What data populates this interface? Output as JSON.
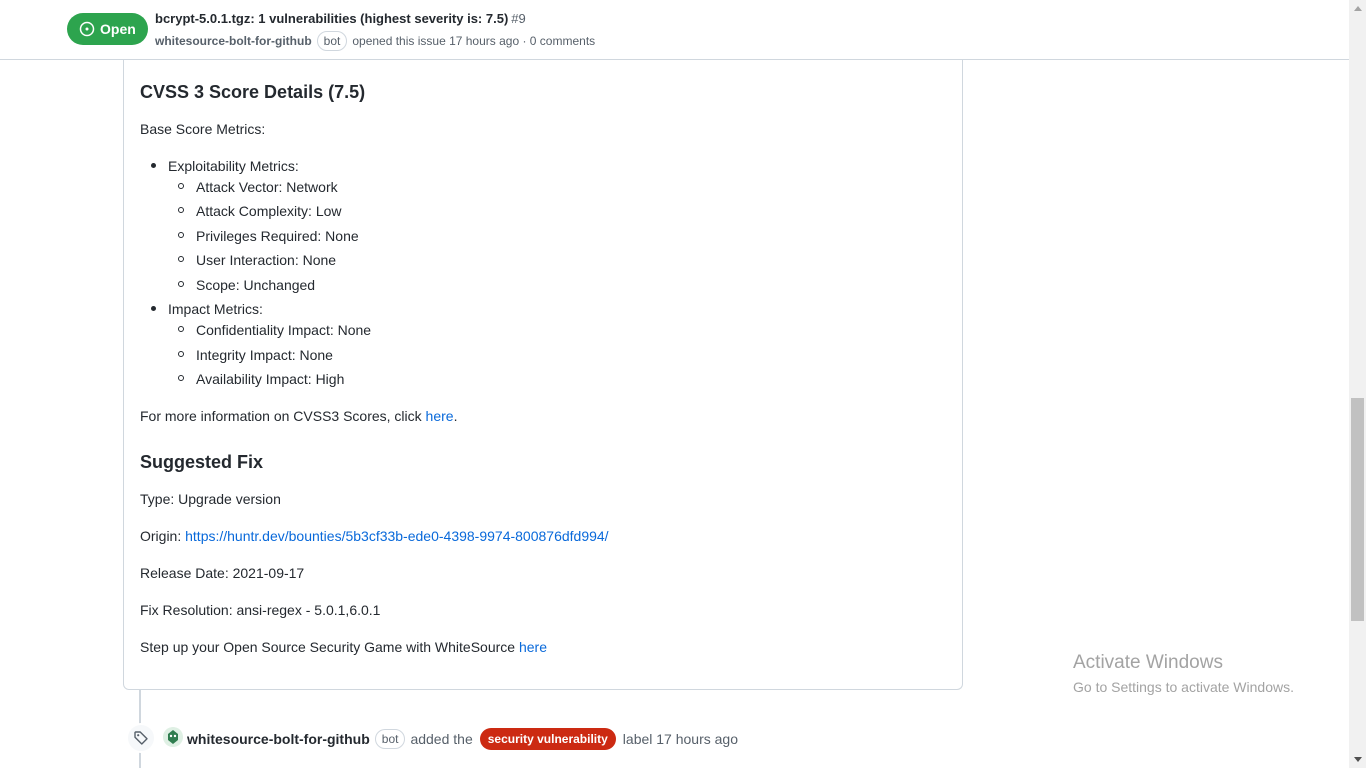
{
  "header": {
    "state": "Open",
    "title": "bcrypt-5.0.1.tgz: 1 vulnerabilities (highest severity is: 7.5)",
    "number": "#9",
    "author": "whitesource-bolt-for-github",
    "bot_label": "bot",
    "meta_text": "opened this issue 17 hours ago · 0 comments"
  },
  "body": {
    "cvss_heading": "CVSS 3 Score Details (7.5)",
    "base_metrics": "Base Score Metrics:",
    "exploitability": {
      "label": "Exploitability Metrics:",
      "items": [
        "Attack Vector: Network",
        "Attack Complexity: Low",
        "Privileges Required: None",
        "User Interaction: None",
        "Scope: Unchanged"
      ]
    },
    "impact": {
      "label": "Impact Metrics:",
      "items": [
        "Confidentiality Impact: None",
        "Integrity Impact: None",
        "Availability Impact: High"
      ]
    },
    "more_info_prefix": "For more information on CVSS3 Scores, click ",
    "more_info_link": "here",
    "more_info_suffix": ".",
    "fix_heading": "Suggested Fix",
    "type": "Type: Upgrade version",
    "origin_prefix": "Origin: ",
    "origin_link": "https://huntr.dev/bounties/5b3cf33b-ede0-4398-9974-800876dfd994/",
    "release_date": "Release Date: 2021-09-17",
    "fix_resolution": "Fix Resolution: ansi-regex - 5.0.1,6.0.1",
    "stepup_prefix": "Step up your Open Source Security Game with WhiteSource ",
    "stepup_link": "here"
  },
  "timeline": {
    "author": "whitesource-bolt-for-github",
    "bot_label": "bot",
    "action": "added the",
    "label": "security vulnerability",
    "suffix": "label 17 hours ago"
  },
  "watermark": {
    "title": "Activate Windows",
    "subtitle": "Go to Settings to activate Windows."
  },
  "colors": {
    "open_green": "#2da44e",
    "link_blue": "#0969da",
    "label_red": "#cc2a12"
  }
}
